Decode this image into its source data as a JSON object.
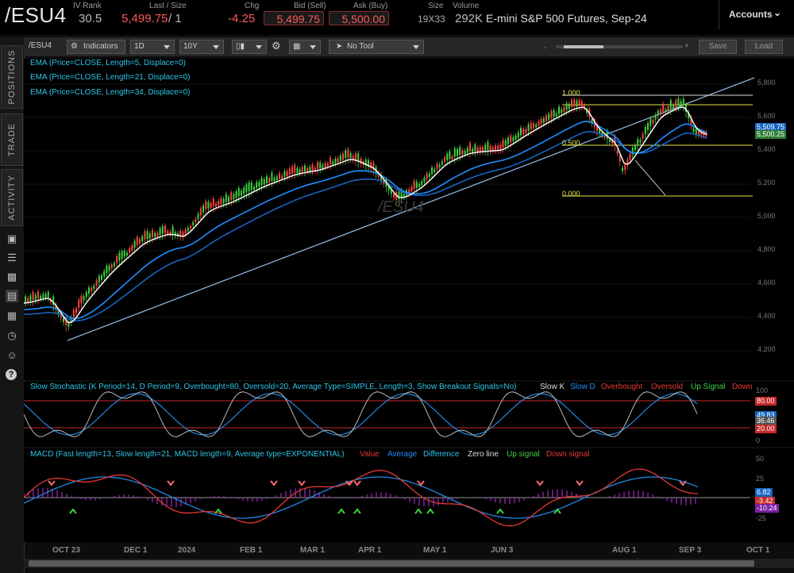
{
  "header": {
    "symbol": "/ESU4",
    "iv_rank_label": "IV Rank",
    "iv_rank": "30.5",
    "last_size_label": "Last / Size",
    "last": "5,499.75",
    "last_size": "/ 1",
    "chg_label": "Chg",
    "chg": "-4.25",
    "bid_label": "Bid (Sell)",
    "bid": "5,499.75",
    "ask_label": "Ask (Buy)",
    "ask": "5,500.00",
    "size_label": "Size",
    "size": "19X33",
    "volume_label": "Volume",
    "volume": "292K",
    "description": "E-mini S&P 500 Futures, Sep-24",
    "accounts_label": "Accounts"
  },
  "sidebar": {
    "tabs": [
      "POSITIONS",
      "TRADE",
      "ACTIVITY"
    ],
    "icons": [
      "monitor-icon",
      "list-icon",
      "clipboard-icon",
      "chart-icon",
      "grid-icon",
      "clock-icon",
      "people-icon",
      "help-icon"
    ]
  },
  "toolbar": {
    "symbol": "/ESU4",
    "indicators_label": "Indicators",
    "interval": "1D",
    "range": "10Y",
    "tool": "No Tool",
    "save_label": "Save",
    "load_label": "Load"
  },
  "price_pane": {
    "studies": [
      "EMA (Price=CLOSE, Length=5, Displace=0)",
      "EMA (Price=CLOSE, Length=21, Displace=0)",
      "EMA (Price=CLOSE, Length=34, Displace=0)"
    ],
    "watermark": "/ESU4",
    "fib": [
      "1.000",
      "0.500",
      "0.000"
    ],
    "axis": [
      "5,800",
      "5,600",
      "5,400",
      "5,200",
      "5,000",
      "4,800",
      "4,600",
      "4,400",
      "4,200"
    ],
    "tags": [
      "5,509.75",
      "5,500.25"
    ]
  },
  "stoch_pane": {
    "title": "Slow Stochastic (K Period=14, D Period=9, Overbought=80, Oversold=20, Average Type=SIMPLE, Length=3, Show Breakout Signals=No)",
    "legend": [
      "Slow K",
      "Slow D",
      "Overbought",
      "Oversold",
      "Up Signal",
      "Down"
    ],
    "axis": [
      "100",
      "80.00",
      "49.83",
      "36.46",
      "20.00",
      "0"
    ]
  },
  "macd_pane": {
    "title": "MACD (Fast length=13, Slow length=21, MACD length=9, Average type=EXPONENTIAL)",
    "legend": [
      "Value",
      "Average",
      "Difference",
      "Zero line",
      "Up signal",
      "Down signal"
    ],
    "axis": [
      "50",
      "25",
      "6.82",
      "-3.42",
      "-10.24",
      "-25"
    ]
  },
  "x_axis": [
    "OCT 23",
    "DEC 1",
    "2024",
    "FEB 1",
    "MAR 1",
    "APR 1",
    "MAY 1",
    "JUN 3",
    "AUG 1",
    "SEP 3",
    "OCT 1"
  ],
  "colors": {
    "up": "#3fd13f",
    "down": "#ff4444",
    "ema_fast": "#ffffff",
    "ema_mid": "#1e90ff",
    "ema_slow": "#1565c0",
    "study_text": "#2ec4e8",
    "fib": "#e6e64c"
  }
}
